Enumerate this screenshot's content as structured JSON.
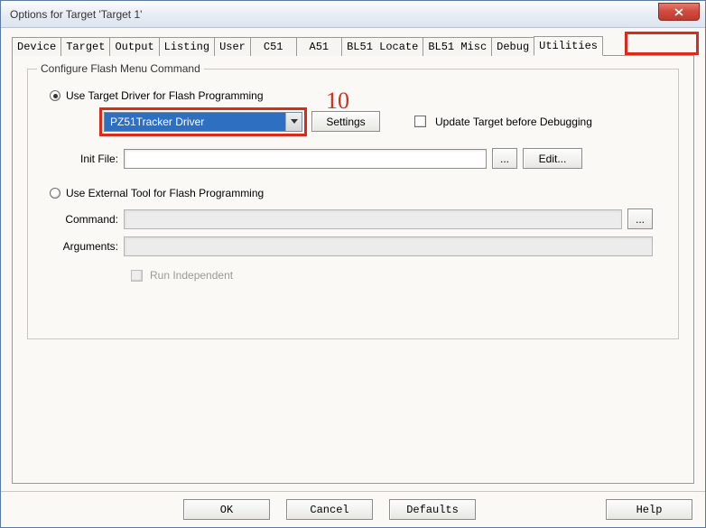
{
  "window": {
    "title": "Options for Target 'Target 1'"
  },
  "tabs": {
    "device": "Device",
    "target": "Target",
    "output": "Output",
    "listing": "Listing",
    "user": "User",
    "c51": "C51",
    "a51": "A51",
    "bl51_locate": "BL51 Locate",
    "bl51_misc": "BL51 Misc",
    "debug": "Debug",
    "utilities": "Utilities"
  },
  "group": {
    "title": "Configure Flash Menu Command",
    "radio_target": "Use Target Driver for Flash Programming",
    "driver_selected": "PZ51Tracker Driver",
    "settings_btn": "Settings",
    "update_target": "Update Target before Debugging",
    "init_file_label": "Init File:",
    "init_file_value": "",
    "browse": "...",
    "edit_btn": "Edit...",
    "radio_external": "Use External Tool for Flash Programming",
    "command_label": "Command:",
    "command_value": "",
    "arguments_label": "Arguments:",
    "arguments_value": "",
    "run_independent": "Run Independent"
  },
  "annotation": {
    "number": "10"
  },
  "buttons": {
    "ok": "OK",
    "cancel": "Cancel",
    "defaults": "Defaults",
    "help": "Help"
  }
}
